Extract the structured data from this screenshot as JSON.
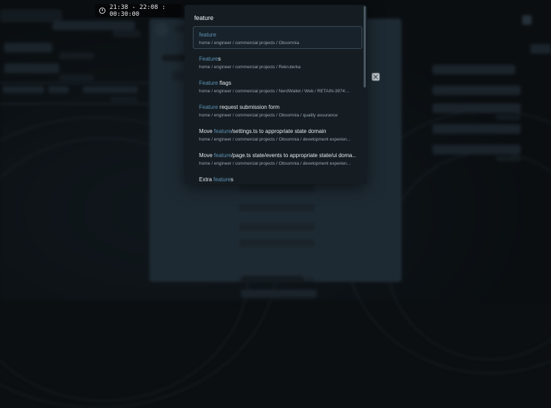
{
  "timebar": {
    "range": "21:38 - 22:08 : 00:30:00"
  },
  "search": {
    "value": "feature"
  },
  "results": [
    {
      "title_before": "",
      "title_match": "feature",
      "title_after": "",
      "path": "home / engineer / commercial projects / Obsomnia",
      "selected": true
    },
    {
      "title_before": "",
      "title_match": "Feature",
      "title_after": "s",
      "path": "home / engineer / commercial projects / Rekruterka",
      "selected": false
    },
    {
      "title_before": "",
      "title_match": "Feature",
      "title_after": " flags",
      "path": "home / engineer / commercial projects / NerdWallet / Web / RETAIN-3974:...",
      "selected": false
    },
    {
      "title_before": "",
      "title_match": "Feature",
      "title_after": " request submission form",
      "path": "home / engineer / commercial projects / Obsomnia / quality assurance",
      "selected": false
    },
    {
      "title_before": "Move ",
      "title_match": "feature",
      "title_after": "/settings.ts to appropriate state domain",
      "path": "home / engineer / commercial projects / Obsomnia / development experien...",
      "selected": false
    },
    {
      "title_before": "Move ",
      "title_match": "feature",
      "title_after": "/page.ts state/events to appropriate state/ui doma...",
      "path": "home / engineer / commercial projects / Obsomnia / development experien...",
      "selected": false
    },
    {
      "title_before": "Extra ",
      "title_match": "feature",
      "title_after": "s",
      "path": "",
      "selected": false
    }
  ],
  "colors": {
    "highlight": "#5f93b4",
    "palette_bg": "#151d23",
    "background": "#0b0f12"
  },
  "icons": {
    "clock": "clock-icon",
    "close": "close-icon"
  }
}
